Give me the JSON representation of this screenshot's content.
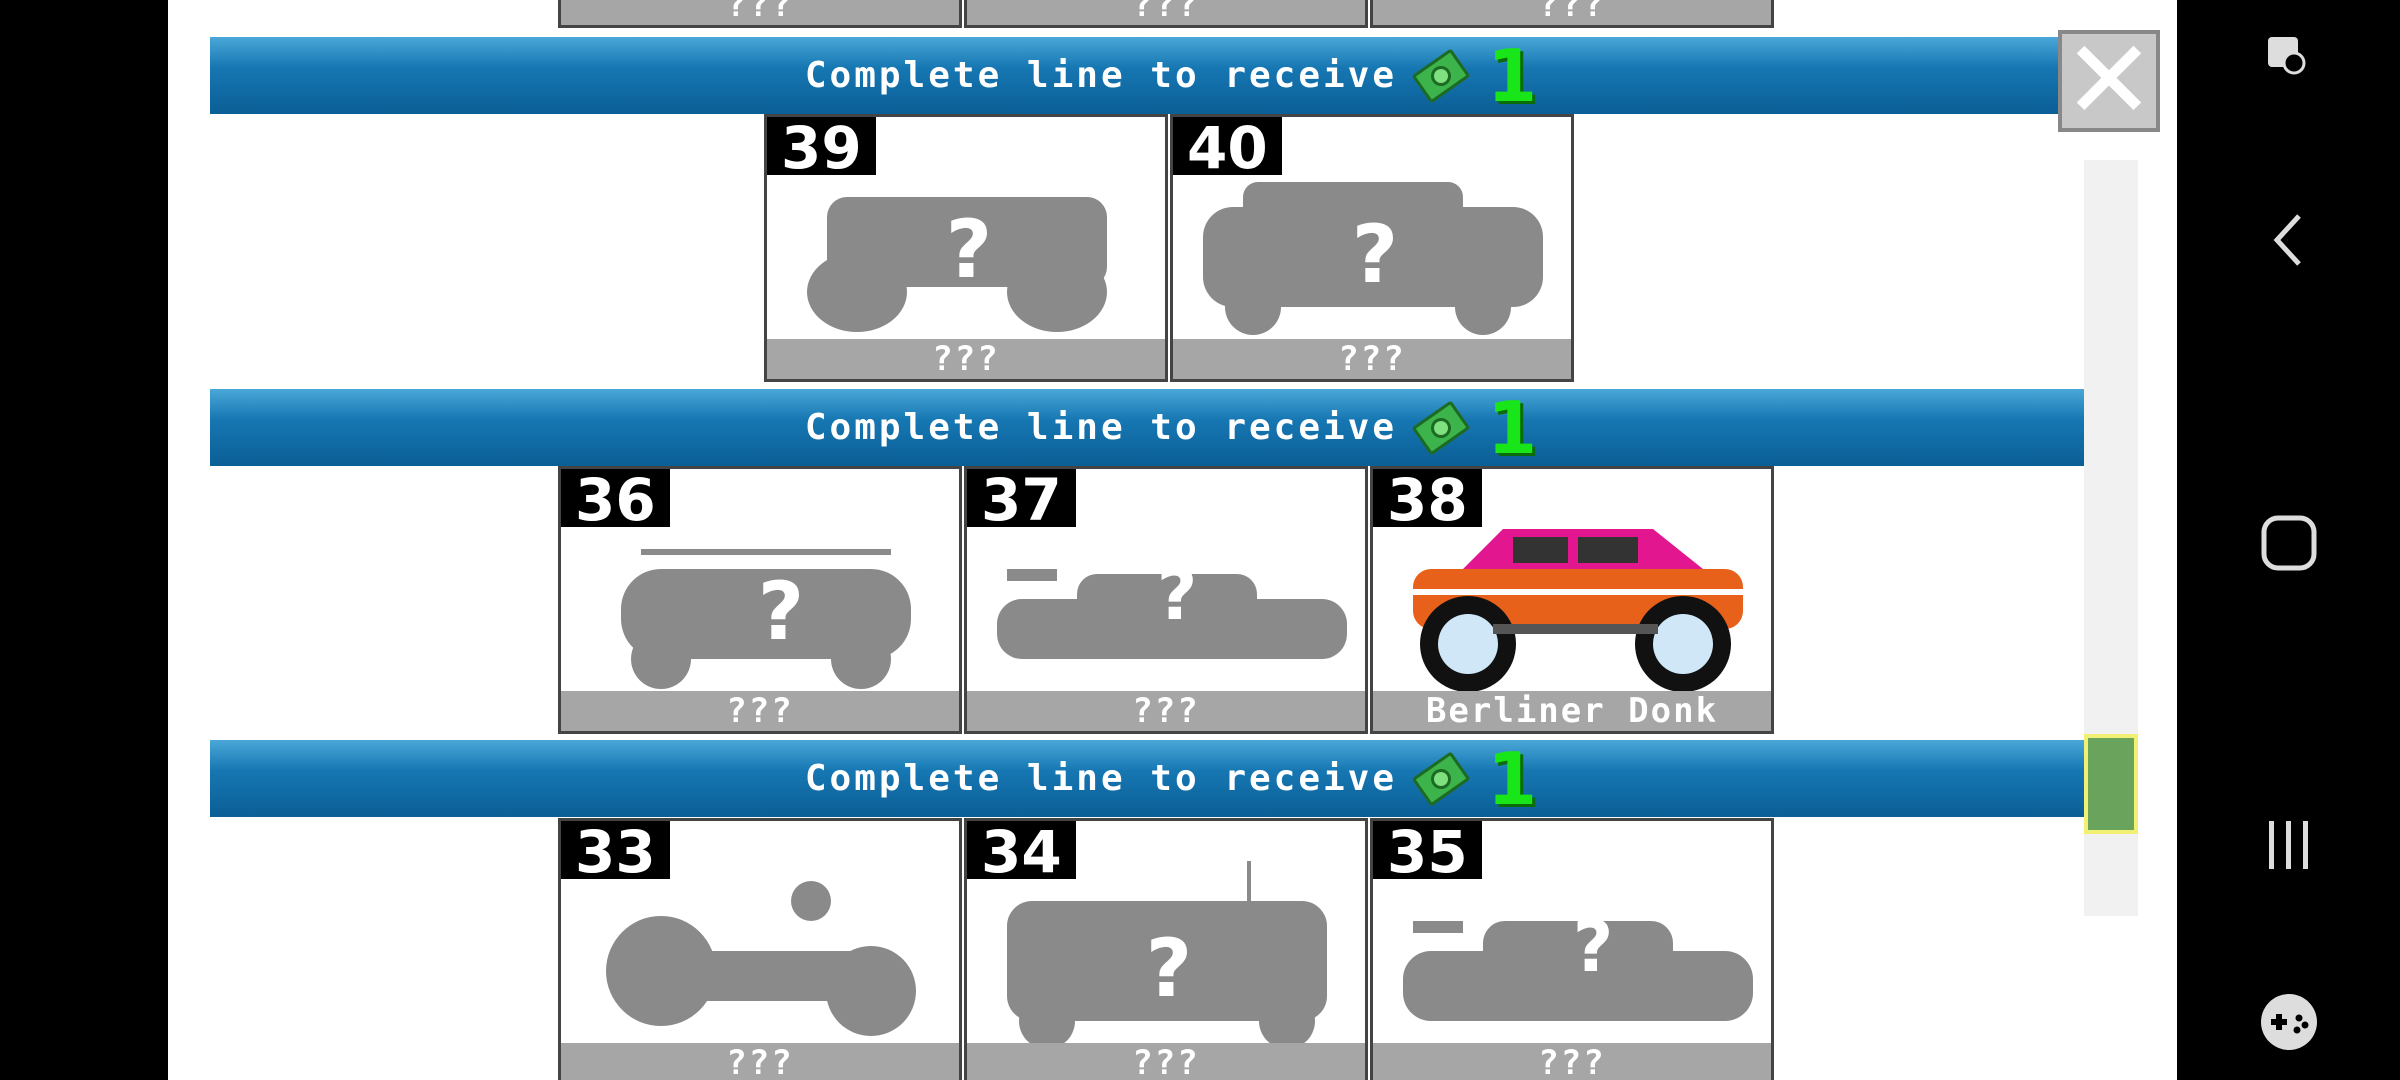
{
  "banners": {
    "text": "Complete line to receive",
    "reward": "1"
  },
  "rows": [
    {
      "cards": [
        {
          "num": "",
          "name": "???"
        },
        {
          "num": "",
          "name": "???"
        },
        {
          "num": "",
          "name": "???"
        }
      ]
    },
    {
      "cards": [
        {
          "num": "39",
          "name": "???"
        },
        {
          "num": "40",
          "name": "???"
        }
      ]
    },
    {
      "cards": [
        {
          "num": "36",
          "name": "???"
        },
        {
          "num": "37",
          "name": "???"
        },
        {
          "num": "38",
          "name": "Berliner Donk"
        }
      ]
    },
    {
      "cards": [
        {
          "num": "33",
          "name": "???"
        },
        {
          "num": "34",
          "name": "???"
        },
        {
          "num": "35",
          "name": "???"
        }
      ]
    }
  ],
  "close_label": "✕",
  "colors": {
    "banner": "#1677b2",
    "reward": "#19e619",
    "locked": "#a6a6a6"
  }
}
